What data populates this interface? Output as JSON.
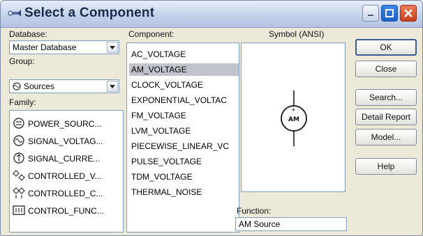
{
  "window": {
    "title": "Select a Component",
    "title_icon": "component-wand-icon",
    "controls": [
      "minimize-icon",
      "maximize-icon",
      "close-icon"
    ]
  },
  "database": {
    "label": "Database:",
    "value": "Master Database"
  },
  "group": {
    "label": "Group:",
    "value": "Sources",
    "icon": "sources-icon"
  },
  "family": {
    "label": "Family:",
    "items": [
      {
        "label": "POWER_SOURC...",
        "icon": "power-source-icon"
      },
      {
        "label": "SIGNAL_VOLTAG...",
        "icon": "signal-voltage-icon"
      },
      {
        "label": "SIGNAL_CURRE...",
        "icon": "signal-current-icon"
      },
      {
        "label": "CONTROLLED_V...",
        "icon": "controlled-voltage-icon"
      },
      {
        "label": "CONTROLLED_C...",
        "icon": "controlled-current-icon"
      },
      {
        "label": "CONTROL_FUNC...",
        "icon": "control-function-icon"
      }
    ]
  },
  "component": {
    "label": "Component:",
    "items": [
      "AC_VOLTAGE",
      "AM_VOLTAGE",
      "CLOCK_VOLTAGE",
      "EXPONENTIAL_VOLTAC",
      "FM_VOLTAGE",
      "LVM_VOLTAGE",
      "PIECEWISE_LINEAR_VC",
      "PULSE_VOLTAGE",
      "TDM_VOLTAGE",
      "THERMAL_NOISE"
    ],
    "selected": "AM_VOLTAGE"
  },
  "symbol": {
    "label": "Symbol (ANSI)",
    "glyph": "AM",
    "icon": "am-voltage-source-symbol"
  },
  "function": {
    "label": "Function:",
    "value": "AM Source"
  },
  "buttons": {
    "ok": "OK",
    "close": "Close",
    "search": "Search...",
    "detail_report": "Detail Report",
    "model": "Model...",
    "help": "Help"
  },
  "colors": {
    "selection": "#c2c4cc",
    "dialog_bg": "#ece9d8",
    "field_border": "#7f9db9"
  }
}
